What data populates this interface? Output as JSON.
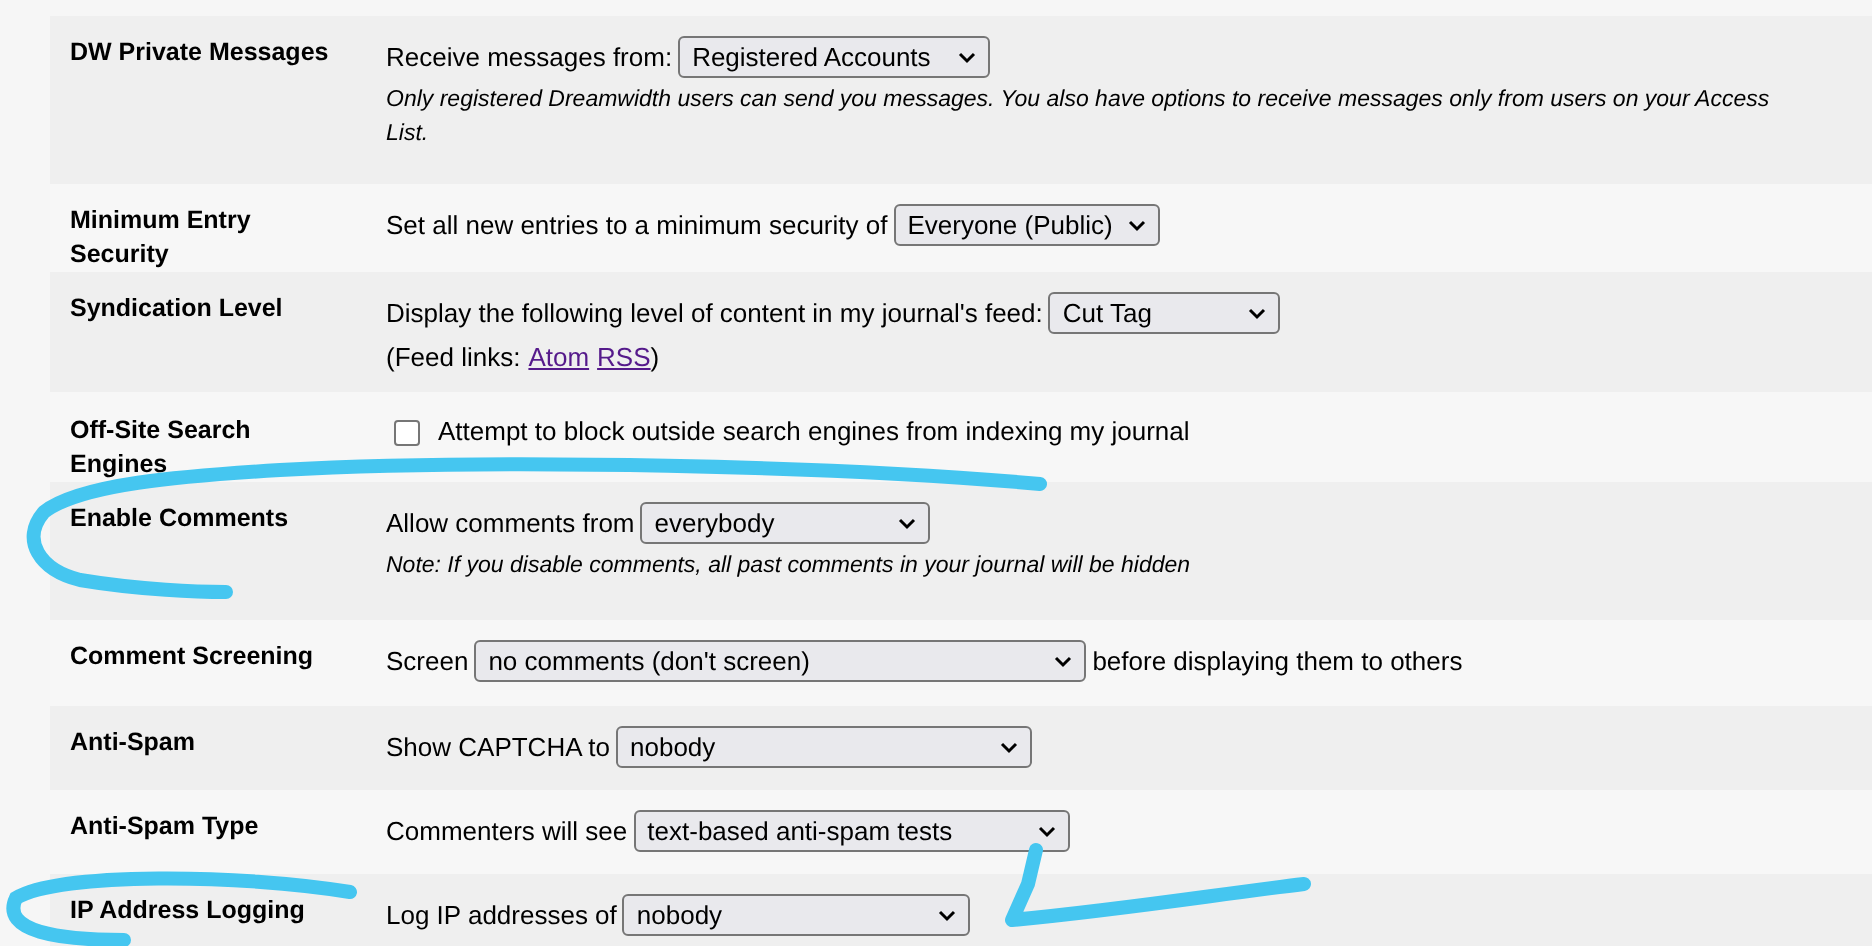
{
  "settings": [
    {
      "kind": "select",
      "label": "DW Private Messages",
      "prefix": "Receive messages from:",
      "select": "Registered Accounts",
      "note": "Only registered Dreamwidth users can send you messages. You also have options to receive messages only from users on your Access List."
    },
    {
      "kind": "select",
      "label": "Minimum Entry Security",
      "prefix": "Set all new entries to a minimum security of",
      "select": "Everyone (Public)"
    },
    {
      "kind": "select",
      "label": "Syndication Level",
      "prefix": "Display the following level of content in my journal's feed:",
      "select": "Cut Tag",
      "feed_links": {
        "prefix": "(Feed links:",
        "links": [
          "Atom",
          "RSS"
        ],
        "suffix": ")"
      }
    },
    {
      "kind": "checkbox",
      "label": "Off-Site Search Engines",
      "checked": false,
      "text": "Attempt to block outside search engines from indexing my journal"
    },
    {
      "kind": "select",
      "label": "Enable Comments",
      "prefix": "Allow comments from",
      "select": "everybody",
      "note": "Note: If you disable comments, all past comments in your journal will be hidden"
    },
    {
      "kind": "select",
      "label": "Comment Screening",
      "prefix": "Screen",
      "select": "no comments (don't screen)",
      "suffix": "before displaying them to others"
    },
    {
      "kind": "select",
      "label": "Anti-Spam",
      "prefix": "Show CAPTCHA to",
      "select": "nobody"
    },
    {
      "kind": "select",
      "label": "Anti-Spam Type",
      "prefix": "Commenters will see",
      "select": "text-based anti-spam tests"
    },
    {
      "kind": "select",
      "label": "IP Address Logging",
      "prefix": "Log IP addresses of",
      "select": "nobody"
    }
  ]
}
